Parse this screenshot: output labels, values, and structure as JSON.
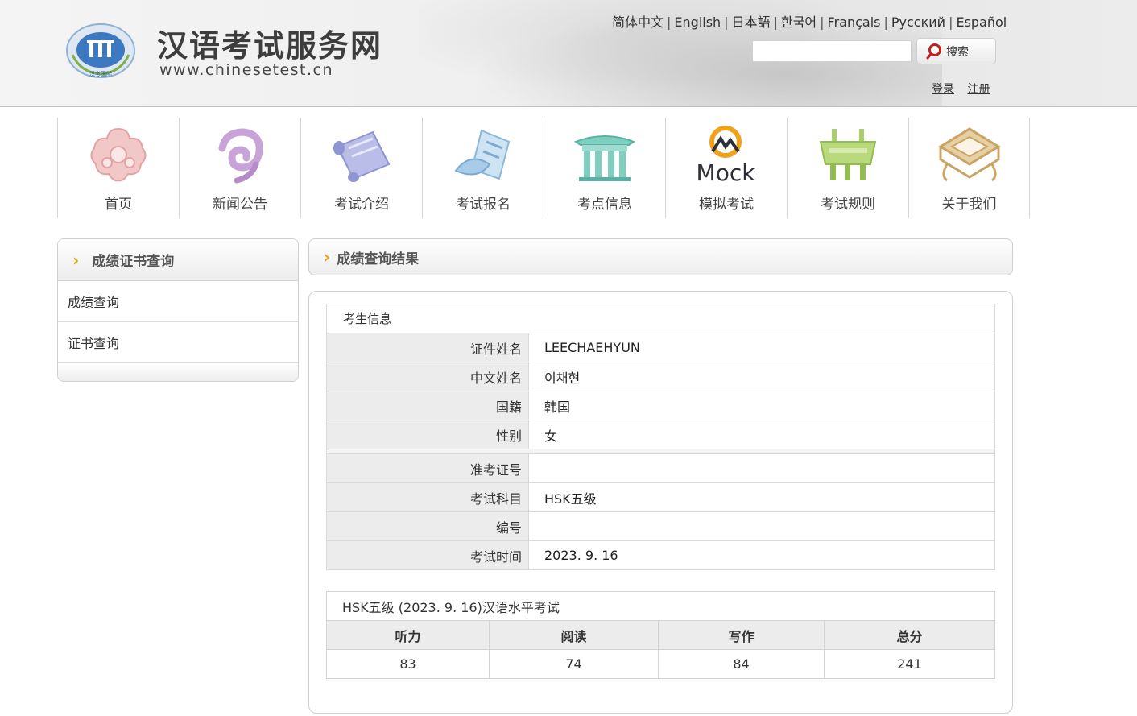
{
  "header": {
    "site_title": "汉语考试服务网",
    "site_url": "www.chinesetest.cn",
    "emblem_text": "汉考国际",
    "languages": [
      "简体中文",
      "English",
      "日本語",
      "한국어",
      "Français",
      "Русский",
      "Español"
    ],
    "search_placeholder": "",
    "search_label": "搜索",
    "login_label": "登录",
    "register_label": "注册"
  },
  "nav": [
    {
      "label": "首页",
      "icon": "cloud-knot-icon"
    },
    {
      "label": "新闻公告",
      "icon": "swirl-icon"
    },
    {
      "label": "考试介绍",
      "icon": "scroll-icon"
    },
    {
      "label": "考试报名",
      "icon": "registration-icon"
    },
    {
      "label": "考点信息",
      "icon": "pavilion-icon"
    },
    {
      "label": "模拟考试",
      "icon": "mock-icon",
      "icon_text": "Mock"
    },
    {
      "label": "考试规则",
      "icon": "ding-vessel-icon"
    },
    {
      "label": "关于我们",
      "icon": "frame-icon"
    }
  ],
  "sidebar": {
    "title": "成绩证书查询",
    "items": [
      {
        "label": "成绩查询"
      },
      {
        "label": "证书查询"
      }
    ]
  },
  "main": {
    "title": "成绩查询结果",
    "info_caption": "考生信息",
    "info_rows": [
      {
        "key": "证件姓名",
        "value": "LEECHAEHYUN"
      },
      {
        "key": "中文姓名",
        "value": "이채현"
      },
      {
        "key": "国籍",
        "value": "韩国"
      },
      {
        "key": "性别",
        "value": "女"
      }
    ],
    "exam_rows": [
      {
        "key": "准考证号",
        "value": ""
      },
      {
        "key": "考试科目",
        "value": "HSK五级"
      },
      {
        "key": "编号",
        "value": ""
      },
      {
        "key": "考试时间",
        "value": "2023. 9. 16"
      }
    ],
    "score_caption": "HSK五级 (2023. 9. 16)汉语水平考试",
    "score_headers": [
      "听力",
      "阅读",
      "写作",
      "总分"
    ],
    "score_values": [
      "83",
      "74",
      "84",
      "241"
    ]
  },
  "colors": {
    "accent_chevron": "#e3a400",
    "header_bg": "#efefef",
    "table_key_bg": "#ececec"
  }
}
